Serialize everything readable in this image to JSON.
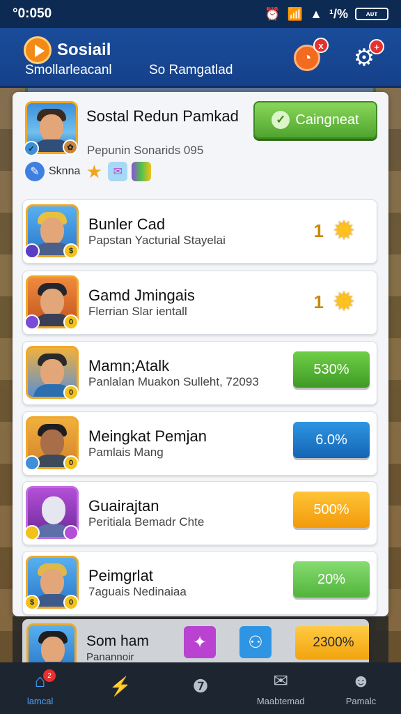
{
  "status_bar": {
    "time": "°0:050",
    "icons": [
      "alarm-icon",
      "wifi-icon",
      "signal-icon",
      "percent-icon",
      "battery-icon"
    ],
    "percent_text": "¹/%",
    "battery_text": "ᴀᴜᴛ"
  },
  "header": {
    "title": "Sosiail",
    "subtitle": "Smollarleacanl",
    "subtitle2": "So Ramgatlad",
    "chat_badge": "x",
    "settings_badge": "+"
  },
  "profile": {
    "name": "Sostal Redun Pamkad",
    "meta": "Pepunin Sonarids 095",
    "tag_label": "Sknna",
    "action_label": "Caingneat"
  },
  "items": [
    {
      "title": "Bunler Cad",
      "subtitle": "Papstan Yacturial Stayelai",
      "value": "1",
      "kind": "star"
    },
    {
      "title": "Gamd Jmingais",
      "subtitle": "Flerrian Slar ientall",
      "value": "1",
      "kind": "star"
    },
    {
      "title": "Mamn;Atalk",
      "subtitle": "Panlalan Muakon Sulleht, 72093",
      "value": "530%",
      "kind": "button",
      "color": "#4fb12f"
    },
    {
      "title": "Meingkat Pemjan",
      "subtitle": "Pamlais Mang",
      "value": "6.0%",
      "kind": "button",
      "color": "#1d7fcf"
    },
    {
      "title": "Guairajtan",
      "subtitle": "Peritiala Bemadr Chte",
      "value": "500%",
      "kind": "button",
      "color": "#f5a20f"
    },
    {
      "title": "Peimgrlat",
      "subtitle": "7aguais Nedinaiaa",
      "value": "20%",
      "kind": "button",
      "color": "#6ac45a"
    }
  ],
  "partial_item": {
    "title": "Som ham",
    "subtitle": "Panannoir",
    "value": "2300%"
  },
  "bottom_nav": [
    {
      "label": "lamcal",
      "icon": "home-icon",
      "badge": "2"
    },
    {
      "label": "",
      "icon": "lightning-icon"
    },
    {
      "label": "",
      "icon": "help-icon"
    },
    {
      "label": "Maabtemad",
      "icon": "mail-icon"
    },
    {
      "label": "Pamalc",
      "icon": "profile-icon"
    }
  ],
  "colors": {
    "header_bg": "#1a4c9a",
    "status_bg": "#0d2a52",
    "primary_green": "#4fa52f",
    "nav_active": "#4aa3ff"
  }
}
